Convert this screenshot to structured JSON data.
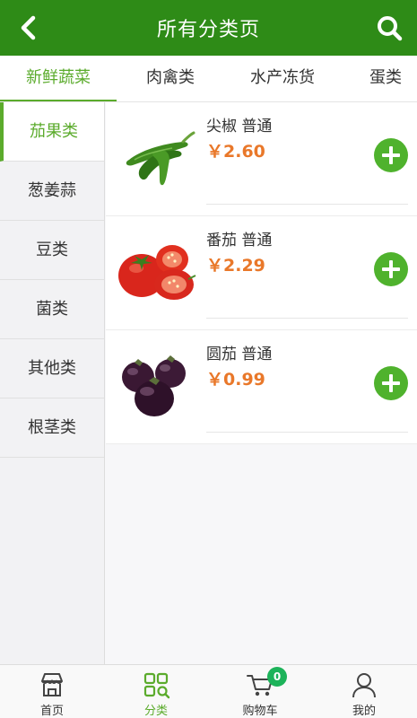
{
  "header": {
    "title": "所有分类页"
  },
  "tabs": [
    {
      "label": "新鲜蔬菜",
      "active": true
    },
    {
      "label": "肉禽类"
    },
    {
      "label": "水产冻货"
    },
    {
      "label": "蛋类"
    }
  ],
  "sidebar": {
    "items": [
      {
        "label": "茄果类",
        "active": true
      },
      {
        "label": "葱姜蒜"
      },
      {
        "label": "豆类"
      },
      {
        "label": "菌类"
      },
      {
        "label": "其他类"
      },
      {
        "label": "根茎类"
      }
    ]
  },
  "products": [
    {
      "name": "尖椒 普通",
      "price": "￥2.60",
      "image": "green-pepper"
    },
    {
      "name": "番茄 普通",
      "price": "￥2.29",
      "image": "tomato"
    },
    {
      "name": "圆茄 普通",
      "price": "￥0.99",
      "image": "eggplant"
    }
  ],
  "bottom_nav": {
    "home": {
      "label": "首页"
    },
    "category": {
      "label": "分类",
      "active": true
    },
    "cart": {
      "label": "购物车",
      "badge": "0"
    },
    "mine": {
      "label": "我的"
    }
  },
  "colors": {
    "brand": "#2e8b17",
    "accent": "#5bab2c",
    "price": "#e9782a",
    "badge": "#1db35a"
  }
}
